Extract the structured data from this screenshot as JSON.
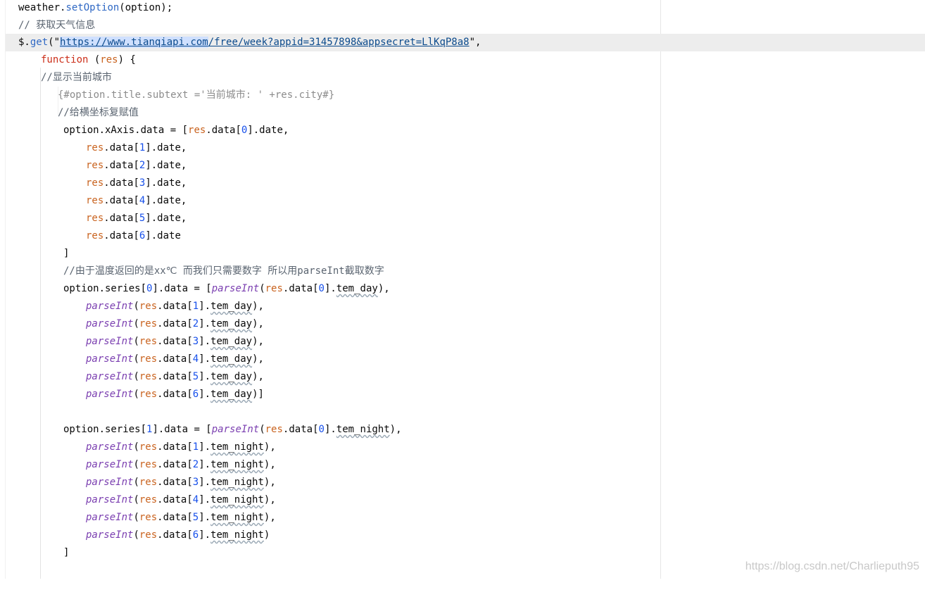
{
  "editor": {
    "line1": [
      "weather.",
      "setOption",
      "(option);"
    ],
    "line2": "// 获取天气信息",
    "line3": {
      "prefix": "$.",
      "get": "get",
      "open": "(\"",
      "url_sel": "https://www.tianqiapi.com",
      "url_rest": "/free/week?appid=31457898&appsecret=LlKqP8a8",
      "close": "\","
    },
    "line4": {
      "kw": "function",
      "open": " (",
      "res": "res",
      "close": ") {"
    },
    "line5": "//显示当前城市",
    "line6": "{#option.title.subtext ='当前城市: ' +res.city#}",
    "line7": "//给横坐标复赋值",
    "line8": {
      "a": "option.xAxis.data = [",
      "res": "res",
      "b": ".data[",
      "n": "0",
      "c": "].date,"
    },
    "date_lines": [
      {
        "res": "res",
        "b": ".data[",
        "n": "1",
        "c": "].date,"
      },
      {
        "res": "res",
        "b": ".data[",
        "n": "2",
        "c": "].date,"
      },
      {
        "res": "res",
        "b": ".data[",
        "n": "3",
        "c": "].date,"
      },
      {
        "res": "res",
        "b": ".data[",
        "n": "4",
        "c": "].date,"
      },
      {
        "res": "res",
        "b": ".data[",
        "n": "5",
        "c": "].date,"
      },
      {
        "res": "res",
        "b": ".data[",
        "n": "6",
        "c": "].date"
      }
    ],
    "close_bracket": "]",
    "comment_temp": "//由于温度返回的是xx℃ 而我们只需要数字 所以用parseInt截取数字",
    "series0": {
      "a": "option.series[",
      "idx": "0",
      "b": "].data = [",
      "pi": "parseInt",
      "o": "(",
      "res": "res",
      "d": ".data[",
      "n": "0",
      "e": "].",
      "prop": "tem_day",
      "f": "),"
    },
    "day_lines": [
      {
        "pi": "parseInt",
        "o": "(",
        "res": "res",
        "d": ".data[",
        "n": "1",
        "e": "].",
        "prop": "tem_day",
        "f": "),"
      },
      {
        "pi": "parseInt",
        "o": "(",
        "res": "res",
        "d": ".data[",
        "n": "2",
        "e": "].",
        "prop": "tem_day",
        "f": "),"
      },
      {
        "pi": "parseInt",
        "o": "(",
        "res": "res",
        "d": ".data[",
        "n": "3",
        "e": "].",
        "prop": "tem_day",
        "f": "),"
      },
      {
        "pi": "parseInt",
        "o": "(",
        "res": "res",
        "d": ".data[",
        "n": "4",
        "e": "].",
        "prop": "tem_day",
        "f": "),"
      },
      {
        "pi": "parseInt",
        "o": "(",
        "res": "res",
        "d": ".data[",
        "n": "5",
        "e": "].",
        "prop": "tem_day",
        "f": "),"
      },
      {
        "pi": "parseInt",
        "o": "(",
        "res": "res",
        "d": ".data[",
        "n": "6",
        "e": "].",
        "prop": "tem_day",
        "f": ")]"
      }
    ],
    "series1": {
      "a": "option.series[",
      "idx": "1",
      "b": "].data = [",
      "pi": "parseInt",
      "o": "(",
      "res": "res",
      "d": ".data[",
      "n": "0",
      "e": "].",
      "prop": "tem_night",
      "f": "),"
    },
    "night_lines": [
      {
        "pi": "parseInt",
        "o": "(",
        "res": "res",
        "d": ".data[",
        "n": "1",
        "e": "].",
        "prop": "tem_night",
        "f": "),"
      },
      {
        "pi": "parseInt",
        "o": "(",
        "res": "res",
        "d": ".data[",
        "n": "2",
        "e": "].",
        "prop": "tem_night",
        "f": "),"
      },
      {
        "pi": "parseInt",
        "o": "(",
        "res": "res",
        "d": ".data[",
        "n": "3",
        "e": "].",
        "prop": "tem_night",
        "f": "),"
      },
      {
        "pi": "parseInt",
        "o": "(",
        "res": "res",
        "d": ".data[",
        "n": "4",
        "e": "].",
        "prop": "tem_night",
        "f": "),"
      },
      {
        "pi": "parseInt",
        "o": "(",
        "res": "res",
        "d": ".data[",
        "n": "5",
        "e": "].",
        "prop": "tem_night",
        "f": "),"
      },
      {
        "pi": "parseInt",
        "o": "(",
        "res": "res",
        "d": ".data[",
        "n": "6",
        "e": "].",
        "prop": "tem_night",
        "f": ")"
      }
    ],
    "final_bracket": "]"
  },
  "watermark": "https://blog.csdn.net/Charlieputh95",
  "colors": {
    "keyword": "#cc2f1a",
    "function_call": "#7a3eb0",
    "method": "#2f68c4",
    "param": "#c9631f",
    "number": "#1750eb",
    "comment": "#5a6470",
    "url": "#0b4a8c",
    "current_line": "#ededed"
  }
}
